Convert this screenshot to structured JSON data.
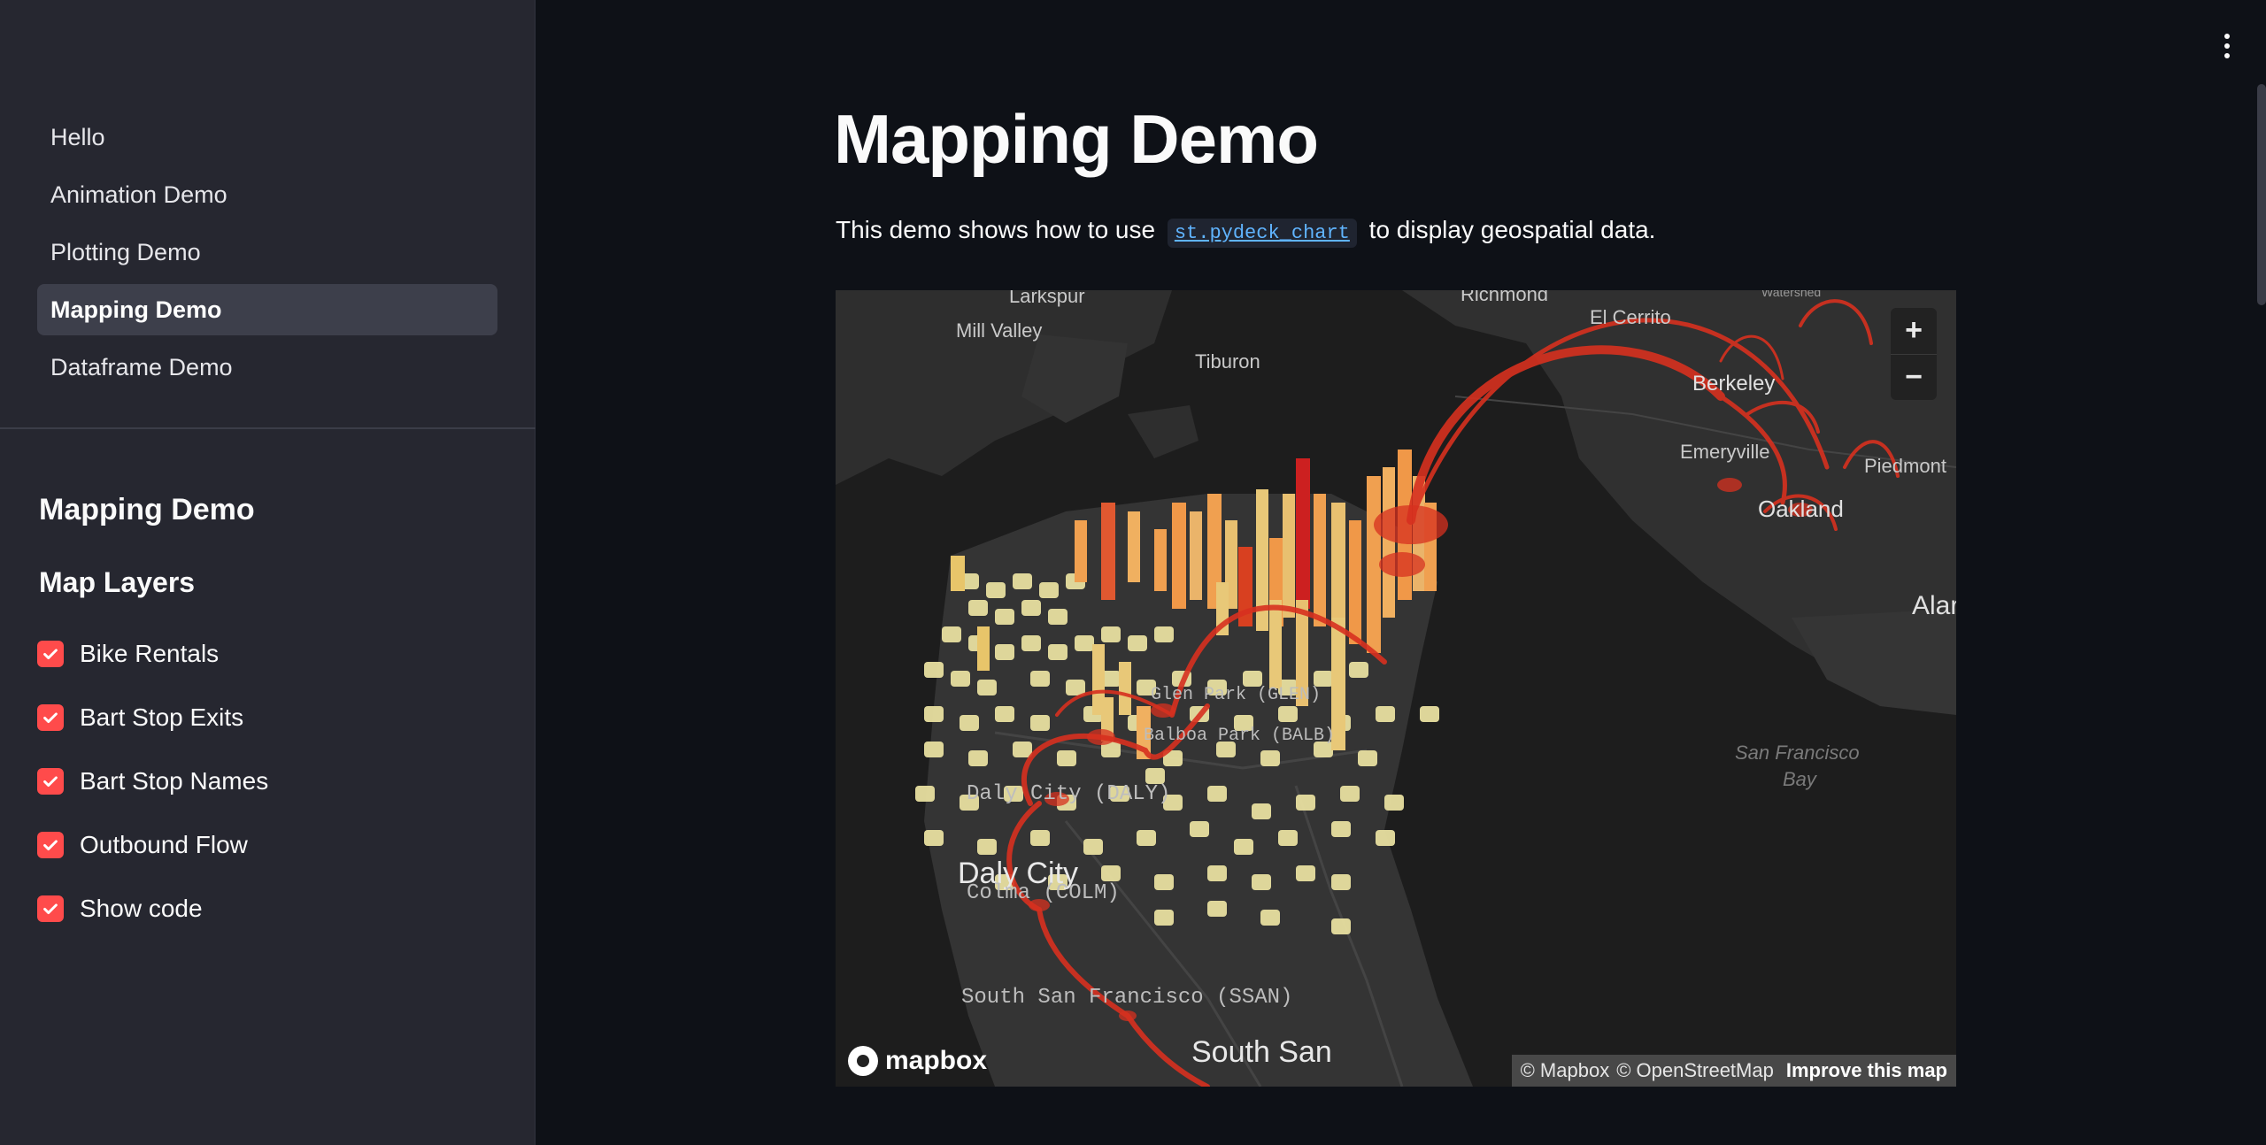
{
  "sidebar": {
    "nav": [
      {
        "label": "Hello",
        "active": false
      },
      {
        "label": "Animation Demo",
        "active": false
      },
      {
        "label": "Plotting Demo",
        "active": false
      },
      {
        "label": "Mapping Demo",
        "active": true
      },
      {
        "label": "Dataframe Demo",
        "active": false
      }
    ],
    "title": "Mapping Demo",
    "subtitle": "Map Layers",
    "checkboxes": [
      {
        "label": "Bike Rentals",
        "checked": true
      },
      {
        "label": "Bart Stop Exits",
        "checked": true
      },
      {
        "label": "Bart Stop Names",
        "checked": true
      },
      {
        "label": "Outbound Flow",
        "checked": true
      },
      {
        "label": "Show code",
        "checked": true
      }
    ]
  },
  "main": {
    "title": "Mapping Demo",
    "intro_before": "This demo shows how to use",
    "intro_code": "st.pydeck_chart",
    "intro_after": "to display geospatial data."
  },
  "map": {
    "labels": {
      "larkspur": "Larkspur",
      "mill_valley": "Mill Valley",
      "tiburon": "Tiburon",
      "richmond": "Richmond",
      "el_cerrito": "El Cerrito",
      "watershed": "Watershed",
      "berkeley": "Berkeley",
      "emeryville": "Emeryville",
      "piedmont": "Piedmont",
      "oakland": "Oakland",
      "alameda": "Alar",
      "sf_bay_1": "San Francisco",
      "sf_bay_2": "Bay",
      "daly_city": "Daly City",
      "daly_city_bart": "Daly City (DALY)",
      "colma_bart": "Colma (COLM)",
      "glen_park_bart": "Glen Park (GLEN)",
      "balboa_bart": "Balboa Park (BALB)",
      "ssan_bart": "South San Francisco (SSAN)",
      "south_san": "South San"
    },
    "zoom_in": "+",
    "zoom_out": "−",
    "logo": "mapbox",
    "attribution_mapbox": "© Mapbox",
    "attribution_osm": "© OpenStreetMap",
    "attribution_improve": "Improve this map"
  },
  "colors": {
    "accent": "#ff4b4b",
    "sidebar_bg": "#262730",
    "main_bg": "#0e1117",
    "arc": "#d7301f",
    "hex_low": "#f5e6a8",
    "hex_mid": "#f0a050",
    "hex_high": "#d7301f"
  },
  "icons": {
    "checkbox": "check-icon",
    "menu": "kebab-menu-icon",
    "zoom_in": "plus-icon",
    "zoom_out": "minus-icon"
  }
}
